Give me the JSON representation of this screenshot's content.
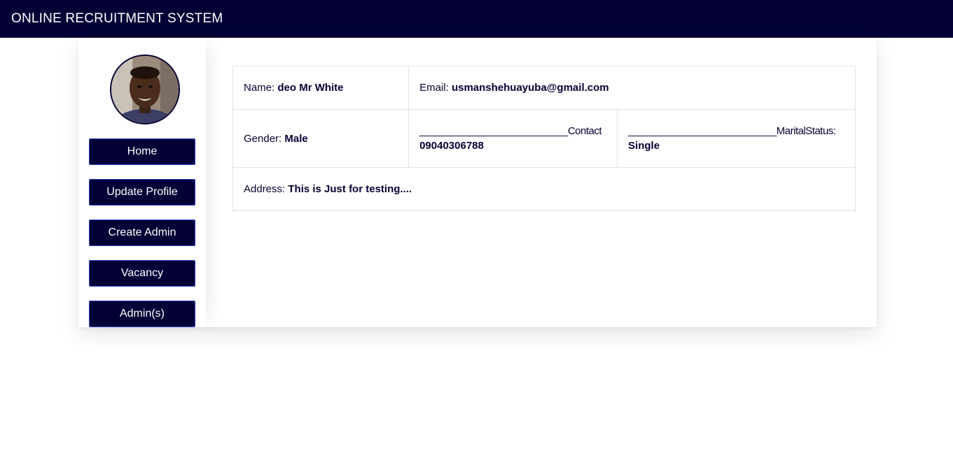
{
  "app": {
    "title": "ONLINE RECRUITMENT SYSTEM"
  },
  "sidebar": {
    "avatar_icon": "user-photo",
    "buttons": [
      {
        "label": "Home"
      },
      {
        "label": "Update Profile"
      },
      {
        "label": "Create Admin"
      },
      {
        "label": "Vacancy"
      },
      {
        "label": "Admin(s)"
      }
    ]
  },
  "profile": {
    "name": {
      "label": "Name: ",
      "value": "deo Mr White"
    },
    "email": {
      "label": "Email: ",
      "value": "usmanshehuayuba@gmail.com"
    },
    "gender": {
      "label": "Gender: ",
      "value": "Male"
    },
    "contact": {
      "label": "___________________________Contact",
      "value": "09040306788"
    },
    "marital": {
      "label": "___________________________MaritalStatus:",
      "value": "Single"
    },
    "address": {
      "label": "Address: ",
      "value": "This is Just for testing...."
    }
  },
  "colors": {
    "navbar": "#020035",
    "button_bg": "#020035",
    "button_border": "#2a3fd8",
    "text": "#050233"
  }
}
